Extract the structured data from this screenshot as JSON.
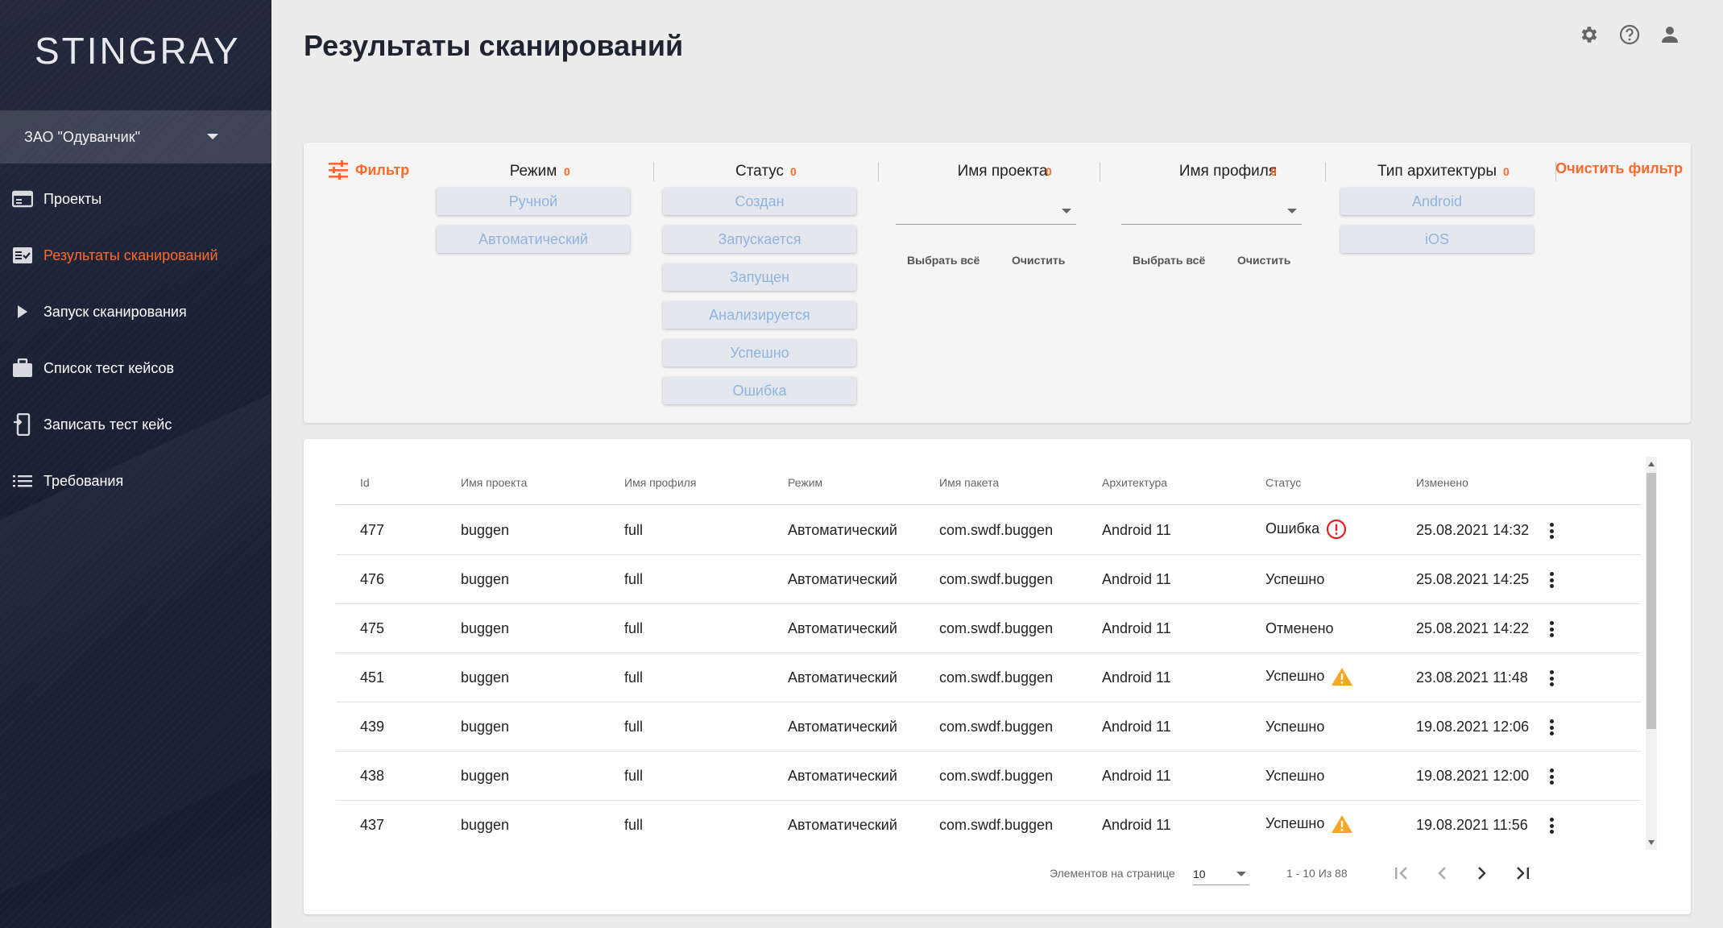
{
  "app": {
    "logo": "STINGRAY"
  },
  "org_selector": {
    "value": "ЗАО \"Одуванчик\""
  },
  "sidebar": {
    "items": [
      {
        "label": "Проекты",
        "icon": "projects-icon",
        "active": false
      },
      {
        "label": "Результаты сканирований",
        "icon": "scan-results-icon",
        "active": true
      },
      {
        "label": "Запуск сканирования",
        "icon": "play-icon",
        "active": false
      },
      {
        "label": "Список тест кейсов",
        "icon": "briefcase-icon",
        "active": false
      },
      {
        "label": "Записать тест кейс",
        "icon": "record-phone-icon",
        "active": false
      },
      {
        "label": "Требования",
        "icon": "list-icon",
        "active": false
      }
    ]
  },
  "page": {
    "title": "Результаты сканирований"
  },
  "colors": {
    "accent": "#ff6a2b",
    "chip_text": "#8fb3e0",
    "error": "#e02020",
    "warning": "#f5a623"
  },
  "filter": {
    "label": "Фильтр",
    "clear_all": "Очистить фильтр",
    "mode": {
      "title": "Режим",
      "count": "0",
      "options": [
        "Ручной",
        "Автоматический"
      ]
    },
    "status": {
      "title": "Статус",
      "count": "0",
      "options": [
        "Создан",
        "Запускается",
        "Запущен",
        "Анализируется",
        "Успешно",
        "Ошибка"
      ]
    },
    "project": {
      "title": "Имя проекта",
      "count": "0",
      "select_all": "Выбрать всё",
      "clear": "Очистить"
    },
    "profile": {
      "title": "Имя профиля",
      "count": "0",
      "select_all": "Выбрать всё",
      "clear": "Очистить"
    },
    "arch": {
      "title": "Тип архитектуры",
      "count": "0",
      "options": [
        "Android",
        "iOS"
      ]
    }
  },
  "table": {
    "columns": [
      "Id",
      "Имя проекта",
      "Имя профиля",
      "Режим",
      "Имя пакета",
      "Архитектура",
      "Статус",
      "Изменено"
    ],
    "rows": [
      {
        "id": "477",
        "project": "buggen",
        "profile": "full",
        "mode": "Автоматический",
        "package": "com.swdf.buggen",
        "arch": "Android 11",
        "status": "Ошибка",
        "status_icon": "error-icon",
        "changed": "25.08.2021 14:32"
      },
      {
        "id": "476",
        "project": "buggen",
        "profile": "full",
        "mode": "Автоматический",
        "package": "com.swdf.buggen",
        "arch": "Android 11",
        "status": "Успешно",
        "status_icon": "",
        "changed": "25.08.2021 14:25"
      },
      {
        "id": "475",
        "project": "buggen",
        "profile": "full",
        "mode": "Автоматический",
        "package": "com.swdf.buggen",
        "arch": "Android 11",
        "status": "Отменено",
        "status_icon": "",
        "changed": "25.08.2021 14:22"
      },
      {
        "id": "451",
        "project": "buggen",
        "profile": "full",
        "mode": "Автоматический",
        "package": "com.swdf.buggen",
        "arch": "Android 11",
        "status": "Успешно",
        "status_icon": "warning-icon",
        "changed": "23.08.2021 11:48"
      },
      {
        "id": "439",
        "project": "buggen",
        "profile": "full",
        "mode": "Автоматический",
        "package": "com.swdf.buggen",
        "arch": "Android 11",
        "status": "Успешно",
        "status_icon": "",
        "changed": "19.08.2021 12:06"
      },
      {
        "id": "438",
        "project": "buggen",
        "profile": "full",
        "mode": "Автоматический",
        "package": "com.swdf.buggen",
        "arch": "Android 11",
        "status": "Успешно",
        "status_icon": "",
        "changed": "19.08.2021 12:00"
      },
      {
        "id": "437",
        "project": "buggen",
        "profile": "full",
        "mode": "Автоматический",
        "package": "com.swdf.buggen",
        "arch": "Android 11",
        "status": "Успешно",
        "status_icon": "warning-icon",
        "changed": "19.08.2021 11:56"
      }
    ]
  },
  "pagination": {
    "per_page_label": "Элементов на странице",
    "per_page_value": "10",
    "range": "1 - 10 Из 88"
  }
}
